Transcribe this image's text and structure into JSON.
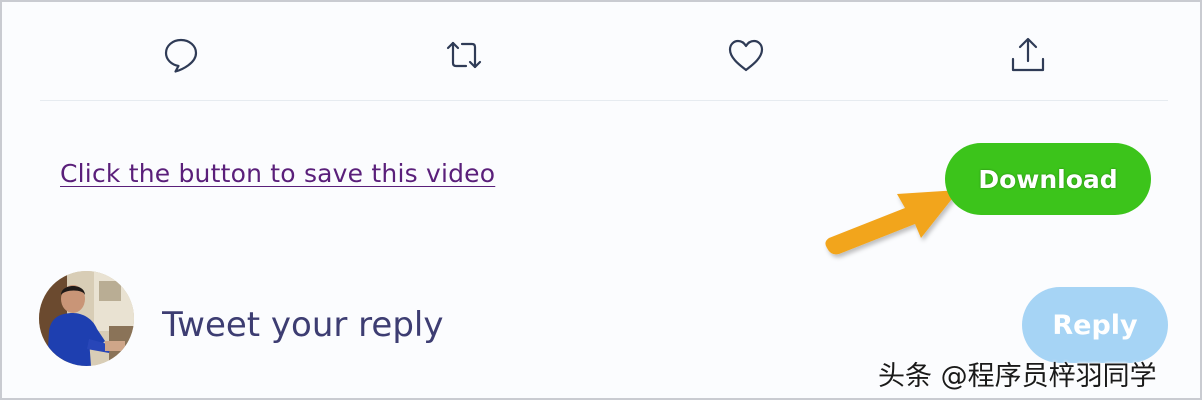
{
  "action_bar": {
    "items": [
      {
        "name": "reply",
        "icon": "speech-bubble-icon"
      },
      {
        "name": "retweet",
        "icon": "retweet-icon"
      },
      {
        "name": "like",
        "icon": "heart-icon"
      },
      {
        "name": "share",
        "icon": "share-upload-icon"
      }
    ],
    "icon_color": "#2f3b56"
  },
  "save_section": {
    "link_text": "Click the button to save this video",
    "download_label": "Download",
    "download_color": "#3cc41b",
    "link_color": "#5a1f7a",
    "arrow_color": "#f2a51b"
  },
  "reply_section": {
    "placeholder": "Tweet your reply",
    "reply_label": "Reply",
    "reply_color": "#a6d4f5"
  },
  "watermark": {
    "text": "头条 @程序员梓羽同学"
  }
}
